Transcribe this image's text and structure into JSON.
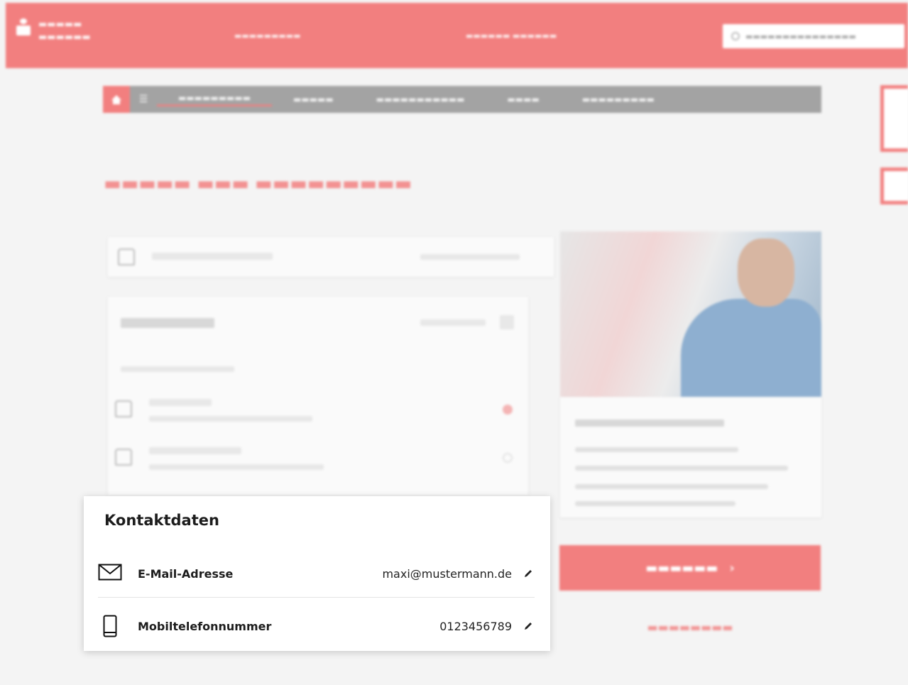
{
  "contact_card": {
    "title": "Kontaktdaten",
    "rows": [
      {
        "label": "E-Mail-Adresse",
        "value": "maxi@mustermann.de",
        "icon": "envelope-icon"
      },
      {
        "label": "Mobiltelefonnummer",
        "value": "0123456789",
        "icon": "smartphone-icon"
      }
    ],
    "edit_icon": "pencil-icon"
  },
  "colors": {
    "accent": "#f27f7f",
    "nav_bg": "#a3a3a3",
    "page_bg": "#f4f4f4"
  }
}
